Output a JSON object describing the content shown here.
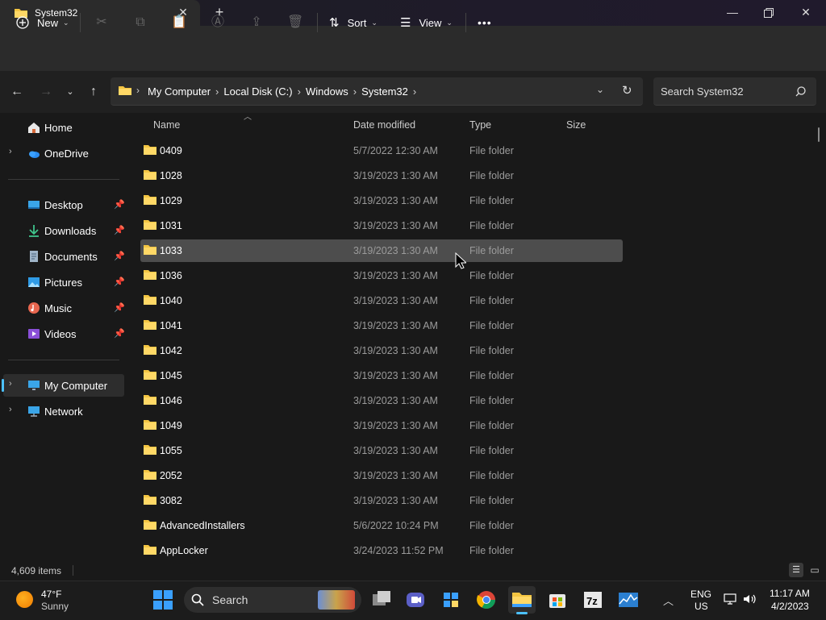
{
  "window": {
    "tab_title": "System32"
  },
  "toolbar": {
    "new_label": "New",
    "sort_label": "Sort",
    "view_label": "View",
    "more_label": "•••"
  },
  "address": {
    "crumbs": [
      "My Computer",
      "Local Disk (C:)",
      "Windows",
      "System32"
    ],
    "search_placeholder": "Search System32"
  },
  "sidebar": {
    "items": [
      {
        "label": "Home",
        "icon": "home-icon"
      },
      {
        "label": "OneDrive",
        "icon": "cloud-icon"
      },
      {
        "label": "Desktop",
        "icon": "desktop-icon"
      },
      {
        "label": "Downloads",
        "icon": "download-icon"
      },
      {
        "label": "Documents",
        "icon": "document-icon"
      },
      {
        "label": "Pictures",
        "icon": "picture-icon"
      },
      {
        "label": "Music",
        "icon": "music-icon"
      },
      {
        "label": "Videos",
        "icon": "video-icon"
      },
      {
        "label": "My Computer",
        "icon": "computer-icon"
      },
      {
        "label": "Network",
        "icon": "network-icon"
      }
    ]
  },
  "columns": {
    "name": "Name",
    "date": "Date modified",
    "type": "Type",
    "size": "Size"
  },
  "files": [
    {
      "name": "0409",
      "date": "5/7/2022 12:30 AM",
      "type": "File folder"
    },
    {
      "name": "1028",
      "date": "3/19/2023 1:30 AM",
      "type": "File folder"
    },
    {
      "name": "1029",
      "date": "3/19/2023 1:30 AM",
      "type": "File folder"
    },
    {
      "name": "1031",
      "date": "3/19/2023 1:30 AM",
      "type": "File folder"
    },
    {
      "name": "1033",
      "date": "3/19/2023 1:30 AM",
      "type": "File folder"
    },
    {
      "name": "1036",
      "date": "3/19/2023 1:30 AM",
      "type": "File folder"
    },
    {
      "name": "1040",
      "date": "3/19/2023 1:30 AM",
      "type": "File folder"
    },
    {
      "name": "1041",
      "date": "3/19/2023 1:30 AM",
      "type": "File folder"
    },
    {
      "name": "1042",
      "date": "3/19/2023 1:30 AM",
      "type": "File folder"
    },
    {
      "name": "1045",
      "date": "3/19/2023 1:30 AM",
      "type": "File folder"
    },
    {
      "name": "1046",
      "date": "3/19/2023 1:30 AM",
      "type": "File folder"
    },
    {
      "name": "1049",
      "date": "3/19/2023 1:30 AM",
      "type": "File folder"
    },
    {
      "name": "1055",
      "date": "3/19/2023 1:30 AM",
      "type": "File folder"
    },
    {
      "name": "2052",
      "date": "3/19/2023 1:30 AM",
      "type": "File folder"
    },
    {
      "name": "3082",
      "date": "3/19/2023 1:30 AM",
      "type": "File folder"
    },
    {
      "name": "AdvancedInstallers",
      "date": "5/6/2022 10:24 PM",
      "type": "File folder"
    },
    {
      "name": "AppLocker",
      "date": "3/24/2023 11:52 PM",
      "type": "File folder"
    }
  ],
  "status": {
    "item_count": "4,609 items"
  },
  "taskbar": {
    "weather_temp": "47°F",
    "weather_desc": "Sunny",
    "search_label": "Search",
    "lang_1": "ENG",
    "lang_2": "US",
    "time": "11:17 AM",
    "date": "4/2/2023"
  },
  "colors": {
    "folder": "#f4c542",
    "accent": "#4cc2ff",
    "selection": "#4d4d4d"
  }
}
